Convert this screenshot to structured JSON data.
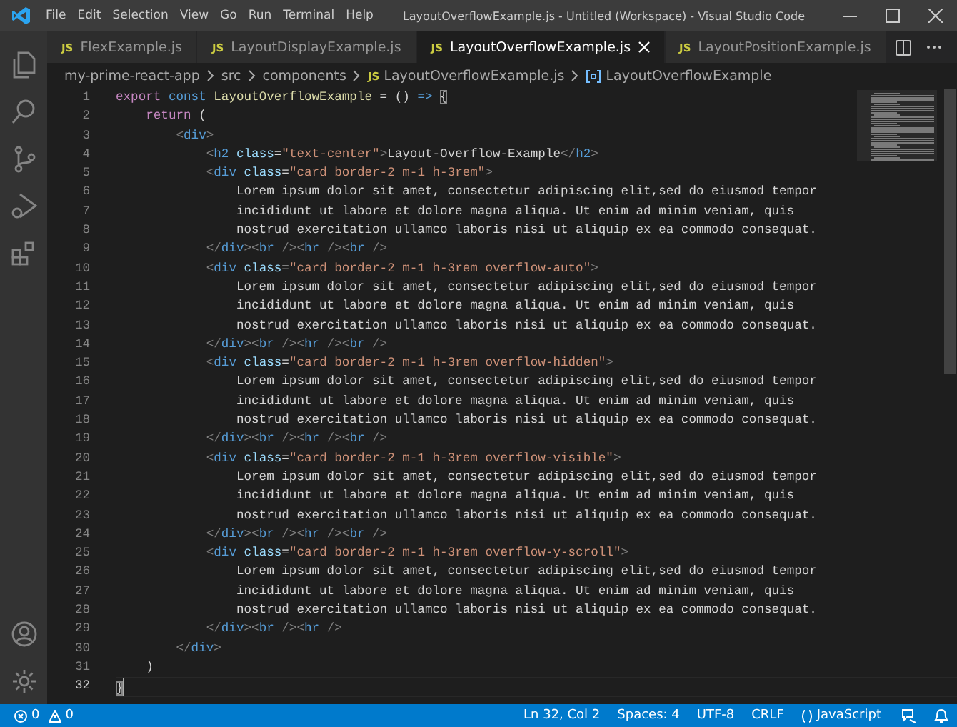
{
  "window": {
    "title": "LayoutOverflowExample.js - Untitled (Workspace) - Visual Studio Code"
  },
  "menu": [
    "File",
    "Edit",
    "Selection",
    "View",
    "Go",
    "Run",
    "Terminal",
    "Help"
  ],
  "tabs": [
    {
      "badge": "JS",
      "label": "FlexExample.js",
      "selected": false
    },
    {
      "badge": "JS",
      "label": "LayoutDisplayExample.js",
      "selected": false
    },
    {
      "badge": "JS",
      "label": "LayoutOverflowExample.js",
      "selected": true
    },
    {
      "badge": "JS",
      "label": "LayoutPositionExample.js",
      "selected": false
    }
  ],
  "breadcrumb": [
    {
      "kind": "folder",
      "label": "my-prime-react-app"
    },
    {
      "kind": "folder",
      "label": "src"
    },
    {
      "kind": "folder",
      "label": "components"
    },
    {
      "kind": "file",
      "badge": "JS",
      "label": "LayoutOverflowExample.js"
    },
    {
      "kind": "symbol",
      "label": "LayoutOverflowExample"
    }
  ],
  "editor": {
    "lines": [
      {
        "number": "1",
        "current": false,
        "tokens": [
          {
            "kind": "control",
            "text": "export"
          },
          {
            "kind": "keyword",
            "text": " const"
          },
          {
            "kind": "function",
            "text": " LayoutOverflowExample"
          },
          {
            "kind": "text",
            "text": " = () "
          },
          {
            "kind": "keyword",
            "text": "=> "
          },
          {
            "kind": "match",
            "text": "{"
          }
        ]
      },
      {
        "number": "2",
        "current": false,
        "tokens": [
          {
            "kind": "control",
            "text": "    return"
          },
          {
            "kind": "text",
            "text": " ("
          }
        ]
      },
      {
        "number": "3",
        "current": false,
        "tokens": [
          {
            "kind": "bracket",
            "text": "        <"
          },
          {
            "kind": "tag",
            "text": "div"
          },
          {
            "kind": "bracket",
            "text": ">"
          }
        ]
      },
      {
        "number": "4",
        "current": false,
        "tokens": [
          {
            "kind": "bracket",
            "text": "            <"
          },
          {
            "kind": "tag",
            "text": "h2"
          },
          {
            "kind": "attr",
            "text": " class"
          },
          {
            "kind": "text",
            "text": "="
          },
          {
            "kind": "string",
            "text": "\"text-center\""
          },
          {
            "kind": "bracket",
            "text": ">"
          },
          {
            "kind": "text",
            "text": "Layout-Overflow-Example"
          },
          {
            "kind": "bracket",
            "text": "</"
          },
          {
            "kind": "tag",
            "text": "h2"
          },
          {
            "kind": "bracket",
            "text": ">"
          }
        ]
      },
      {
        "number": "5",
        "current": false,
        "tokens": [
          {
            "kind": "bracket",
            "text": "            <"
          },
          {
            "kind": "tag",
            "text": "div"
          },
          {
            "kind": "attr",
            "text": " class"
          },
          {
            "kind": "text",
            "text": "="
          },
          {
            "kind": "string",
            "text": "\"card border-2 m-1 h-3rem\""
          },
          {
            "kind": "bracket",
            "text": ">"
          }
        ]
      },
      {
        "number": "6",
        "current": false,
        "tokens": [
          {
            "kind": "text",
            "text": "                Lorem ipsum dolor sit amet, consectetur adipiscing elit,sed do eiusmod tempor"
          }
        ]
      },
      {
        "number": "7",
        "current": false,
        "tokens": [
          {
            "kind": "text",
            "text": "                incididunt ut labore et dolore magna aliqua. Ut enim ad minim veniam, quis"
          }
        ]
      },
      {
        "number": "8",
        "current": false,
        "tokens": [
          {
            "kind": "text",
            "text": "                nostrud exercitation ullamco laboris nisi ut aliquip ex ea commodo consequat."
          }
        ]
      },
      {
        "number": "9",
        "current": false,
        "tokens": [
          {
            "kind": "bracket",
            "text": "            </"
          },
          {
            "kind": "tag",
            "text": "div"
          },
          {
            "kind": "bracket",
            "text": "><"
          },
          {
            "kind": "tag",
            "text": "br"
          },
          {
            "kind": "bracket",
            "text": " /><"
          },
          {
            "kind": "tag",
            "text": "hr"
          },
          {
            "kind": "bracket",
            "text": " /><"
          },
          {
            "kind": "tag",
            "text": "br"
          },
          {
            "kind": "bracket",
            "text": " />"
          }
        ]
      },
      {
        "number": "10",
        "current": false,
        "tokens": [
          {
            "kind": "bracket",
            "text": "            <"
          },
          {
            "kind": "tag",
            "text": "div"
          },
          {
            "kind": "attr",
            "text": " class"
          },
          {
            "kind": "text",
            "text": "="
          },
          {
            "kind": "string",
            "text": "\"card border-2 m-1 h-3rem overflow-auto\""
          },
          {
            "kind": "bracket",
            "text": ">"
          }
        ]
      },
      {
        "number": "11",
        "current": false,
        "tokens": [
          {
            "kind": "text",
            "text": "                Lorem ipsum dolor sit amet, consectetur adipiscing elit,sed do eiusmod tempor"
          }
        ]
      },
      {
        "number": "12",
        "current": false,
        "tokens": [
          {
            "kind": "text",
            "text": "                incididunt ut labore et dolore magna aliqua. Ut enim ad minim veniam, quis"
          }
        ]
      },
      {
        "number": "13",
        "current": false,
        "tokens": [
          {
            "kind": "text",
            "text": "                nostrud exercitation ullamco laboris nisi ut aliquip ex ea commodo consequat."
          }
        ]
      },
      {
        "number": "14",
        "current": false,
        "tokens": [
          {
            "kind": "bracket",
            "text": "            </"
          },
          {
            "kind": "tag",
            "text": "div"
          },
          {
            "kind": "bracket",
            "text": "><"
          },
          {
            "kind": "tag",
            "text": "br"
          },
          {
            "kind": "bracket",
            "text": " /><"
          },
          {
            "kind": "tag",
            "text": "hr"
          },
          {
            "kind": "bracket",
            "text": " /><"
          },
          {
            "kind": "tag",
            "text": "br"
          },
          {
            "kind": "bracket",
            "text": " />"
          }
        ]
      },
      {
        "number": "15",
        "current": false,
        "tokens": [
          {
            "kind": "bracket",
            "text": "            <"
          },
          {
            "kind": "tag",
            "text": "div"
          },
          {
            "kind": "attr",
            "text": " class"
          },
          {
            "kind": "text",
            "text": "="
          },
          {
            "kind": "string",
            "text": "\"card border-2 m-1 h-3rem overflow-hidden\""
          },
          {
            "kind": "bracket",
            "text": ">"
          }
        ]
      },
      {
        "number": "16",
        "current": false,
        "tokens": [
          {
            "kind": "text",
            "text": "                Lorem ipsum dolor sit amet, consectetur adipiscing elit,sed do eiusmod tempor"
          }
        ]
      },
      {
        "number": "17",
        "current": false,
        "tokens": [
          {
            "kind": "text",
            "text": "                incididunt ut labore et dolore magna aliqua. Ut enim ad minim veniam, quis"
          }
        ]
      },
      {
        "number": "18",
        "current": false,
        "tokens": [
          {
            "kind": "text",
            "text": "                nostrud exercitation ullamco laboris nisi ut aliquip ex ea commodo consequat."
          }
        ]
      },
      {
        "number": "19",
        "current": false,
        "tokens": [
          {
            "kind": "bracket",
            "text": "            </"
          },
          {
            "kind": "tag",
            "text": "div"
          },
          {
            "kind": "bracket",
            "text": "><"
          },
          {
            "kind": "tag",
            "text": "br"
          },
          {
            "kind": "bracket",
            "text": " /><"
          },
          {
            "kind": "tag",
            "text": "hr"
          },
          {
            "kind": "bracket",
            "text": " /><"
          },
          {
            "kind": "tag",
            "text": "br"
          },
          {
            "kind": "bracket",
            "text": " />"
          }
        ]
      },
      {
        "number": "20",
        "current": false,
        "tokens": [
          {
            "kind": "bracket",
            "text": "            <"
          },
          {
            "kind": "tag",
            "text": "div"
          },
          {
            "kind": "attr",
            "text": " class"
          },
          {
            "kind": "text",
            "text": "="
          },
          {
            "kind": "string",
            "text": "\"card border-2 m-1 h-3rem overflow-visible\""
          },
          {
            "kind": "bracket",
            "text": ">"
          }
        ]
      },
      {
        "number": "21",
        "current": false,
        "tokens": [
          {
            "kind": "text",
            "text": "                Lorem ipsum dolor sit amet, consectetur adipiscing elit,sed do eiusmod tempor"
          }
        ]
      },
      {
        "number": "22",
        "current": false,
        "tokens": [
          {
            "kind": "text",
            "text": "                incididunt ut labore et dolore magna aliqua. Ut enim ad minim veniam, quis"
          }
        ]
      },
      {
        "number": "23",
        "current": false,
        "tokens": [
          {
            "kind": "text",
            "text": "                nostrud exercitation ullamco laboris nisi ut aliquip ex ea commodo consequat."
          }
        ]
      },
      {
        "number": "24",
        "current": false,
        "tokens": [
          {
            "kind": "bracket",
            "text": "            </"
          },
          {
            "kind": "tag",
            "text": "div"
          },
          {
            "kind": "bracket",
            "text": "><"
          },
          {
            "kind": "tag",
            "text": "br"
          },
          {
            "kind": "bracket",
            "text": " /><"
          },
          {
            "kind": "tag",
            "text": "hr"
          },
          {
            "kind": "bracket",
            "text": " /><"
          },
          {
            "kind": "tag",
            "text": "br"
          },
          {
            "kind": "bracket",
            "text": " />"
          }
        ]
      },
      {
        "number": "25",
        "current": false,
        "tokens": [
          {
            "kind": "bracket",
            "text": "            <"
          },
          {
            "kind": "tag",
            "text": "div"
          },
          {
            "kind": "attr",
            "text": " class"
          },
          {
            "kind": "text",
            "text": "="
          },
          {
            "kind": "string",
            "text": "\"card border-2 m-1 h-3rem overflow-y-scroll\""
          },
          {
            "kind": "bracket",
            "text": ">"
          }
        ]
      },
      {
        "number": "26",
        "current": false,
        "tokens": [
          {
            "kind": "text",
            "text": "                Lorem ipsum dolor sit amet, consectetur adipiscing elit,sed do eiusmod tempor"
          }
        ]
      },
      {
        "number": "27",
        "current": false,
        "tokens": [
          {
            "kind": "text",
            "text": "                incididunt ut labore et dolore magna aliqua. Ut enim ad minim veniam, quis"
          }
        ]
      },
      {
        "number": "28",
        "current": false,
        "tokens": [
          {
            "kind": "text",
            "text": "                nostrud exercitation ullamco laboris nisi ut aliquip ex ea commodo consequat."
          }
        ]
      },
      {
        "number": "29",
        "current": false,
        "tokens": [
          {
            "kind": "bracket",
            "text": "            </"
          },
          {
            "kind": "tag",
            "text": "div"
          },
          {
            "kind": "bracket",
            "text": "><"
          },
          {
            "kind": "tag",
            "text": "br"
          },
          {
            "kind": "bracket",
            "text": " /><"
          },
          {
            "kind": "tag",
            "text": "hr"
          },
          {
            "kind": "bracket",
            "text": " />"
          }
        ]
      },
      {
        "number": "30",
        "current": false,
        "tokens": [
          {
            "kind": "bracket",
            "text": "        </"
          },
          {
            "kind": "tag",
            "text": "div"
          },
          {
            "kind": "bracket",
            "text": ">"
          }
        ]
      },
      {
        "number": "31",
        "current": false,
        "tokens": [
          {
            "kind": "text",
            "text": "    )"
          }
        ]
      },
      {
        "number": "32",
        "current": true,
        "tokens": [
          {
            "kind": "match",
            "text": "}"
          }
        ]
      }
    ]
  },
  "status_bar": {
    "errors": "0",
    "warnings": "0",
    "items": [
      {
        "kind": "text",
        "label": "Ln 32, Col 2"
      },
      {
        "kind": "text",
        "label": "Spaces: 4"
      },
      {
        "kind": "text",
        "label": "UTF-8"
      },
      {
        "kind": "text",
        "label": "CRLF"
      },
      {
        "kind": "language",
        "label": "JavaScript"
      }
    ]
  }
}
